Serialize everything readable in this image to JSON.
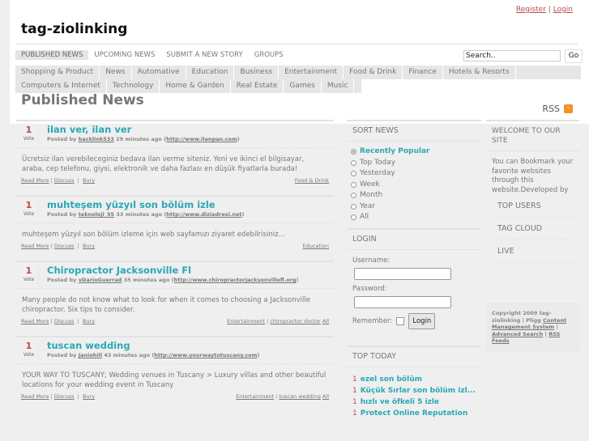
{
  "header": {
    "register": "Register",
    "sep": "|",
    "login": "Login",
    "site_title": "tag-ziolinking"
  },
  "nav": [
    "PUBLISHED NEWS",
    "UPCOMING NEWS",
    "SUBMIT A NEW STORY",
    "GROUPS"
  ],
  "search": {
    "placeholder": "Search..",
    "go": "Go"
  },
  "categories_row1": [
    "Shopping & Product",
    "News",
    "Automative",
    "Education",
    "Business",
    "Entertainment",
    "Food & Drink",
    "Finance",
    "Hotels & Resorts"
  ],
  "categories_row2": [
    "Computers & Internet",
    "Technology",
    "Home & Garden",
    "Real Estate",
    "Games",
    "Music"
  ],
  "page_title": "Published News",
  "rss": "RSS",
  "stories": [
    {
      "votes": "1",
      "vote_label": "Vote",
      "title": "ilan ver, ilan ver",
      "posted_by": "Posted by",
      "user": "backlink533",
      "time": "29 minutes ago",
      "url": "http://www.ilanpan.com",
      "desc": "Ücretsiz ilan verebileceginiz bedava ilan verme siteniz. Yeni ve ikinci el bilgisayar, araba, cep telefonu, giysi, elektronik ve daha fazlası en düşük fiyatlarla burada!",
      "read_more": "Read More",
      "discuss": "Discuss",
      "bury": "Bury",
      "category": "Food & Drink",
      "tags": "",
      "all": ""
    },
    {
      "votes": "1",
      "vote_label": "Vote",
      "title": "muhteşem yüzyıl son bölüm izle",
      "posted_by": "Posted by",
      "user": "teknoloji_55",
      "time": "33 minutes ago",
      "url": "http://www.diziadresi.net",
      "desc": "muhteşem yüzyıl son bölüm izleme için web sayfamızı ziyaret edebilrisiniz...",
      "read_more": "Read More",
      "discuss": "Discuss",
      "bury": "Bury",
      "category": "Education",
      "tags": "",
      "all": ""
    },
    {
      "votes": "1",
      "vote_label": "Vote",
      "title": "Chiropractor Jacksonville Fl",
      "posted_by": "Posted by",
      "user": "vDarioGuerrad",
      "time": "35 minutes ago",
      "url": "http://www.chiropractorjacksonvillefl.org",
      "desc": "Many people do not know what to look for when it comes to choosing a Jacksonville chiropractor. Six tips to consider.",
      "read_more": "Read More",
      "discuss": "Discuss",
      "bury": "Bury",
      "category": "Entertainment",
      "tags": "chiropractor doctor",
      "all": "All"
    },
    {
      "votes": "1",
      "vote_label": "Vote",
      "title": "tuscan wedding",
      "posted_by": "Posted by",
      "user": "Janiehill",
      "time": "43 minutes ago",
      "url": "http://www.yourwaytotuscany.com",
      "desc": "YOUR WAY TO TUSCANY; Wedding venues in Tuscany > Luxury villas and other beautiful locations for your wedding event in Tuscany",
      "read_more": "Read More",
      "discuss": "Discuss",
      "bury": "Bury",
      "category": "Entertainment",
      "tags": "tuscan wedding",
      "all": "All"
    }
  ],
  "sort": {
    "title": "SORT NEWS",
    "options": [
      "Recently Popular",
      "Top Today",
      "Yesterday",
      "Week",
      "Month",
      "Year",
      "All"
    ],
    "selected": 0
  },
  "login_box": {
    "title": "LOGIN",
    "username": "Username:",
    "password": "Password:",
    "remember": "Remember:",
    "button": "Login"
  },
  "top_today": {
    "title": "TOP TODAY",
    "items": [
      {
        "n": "1",
        "t": "ezel son bölüm"
      },
      {
        "n": "1",
        "t": "Küçük Sırlar son bölüm izl..."
      },
      {
        "n": "1",
        "t": "hızlı ve öfkeli 5 izle"
      },
      {
        "n": "1",
        "t": "Protect Online Reputation"
      }
    ]
  },
  "welcome": {
    "title": "WELCOME TO OUR SITE",
    "text": "You can Bookmark your favorite websites through this website.Developed by"
  },
  "side_links": [
    "TOP USERS",
    "TAG CLOUD",
    "LIVE"
  ],
  "footer": {
    "copyright": "Copyright 2009 tag-ziolinking | Pligg",
    "cms": "Content Management System",
    "advanced": "Advanced Search",
    "rss": "RSS Feeds"
  }
}
